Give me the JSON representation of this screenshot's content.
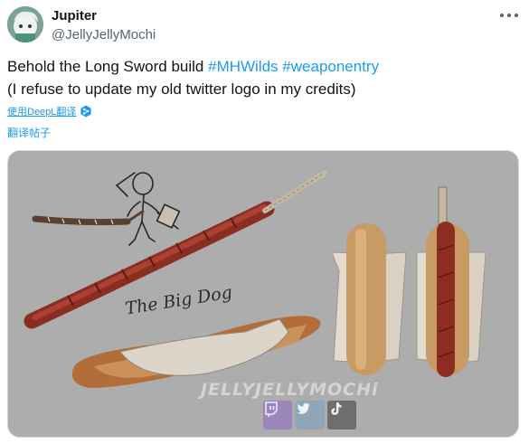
{
  "author": {
    "display_name": "Jupiter",
    "handle": "@JellyJellyMochi"
  },
  "post": {
    "text_line1": "Behold the Long Sword build ",
    "hashtag1": "#MHWilds",
    "hashtag2": "#weaponentry",
    "text_line2": "(I refuse to update my old twitter logo in my credits)"
  },
  "translate": {
    "deepl_label": "使用DeepL翻译",
    "post_label": "翻译帖子"
  },
  "image": {
    "caption": "The Big Dog",
    "watermark": "JELLYJELLYMOCHi",
    "social_icons": [
      "twitch-icon",
      "twitter-icon",
      "tiktok-icon"
    ]
  },
  "colors": {
    "link": "#1d9bf0",
    "text": "#0f1419",
    "muted": "#536471",
    "image_bg": "#adadad"
  }
}
